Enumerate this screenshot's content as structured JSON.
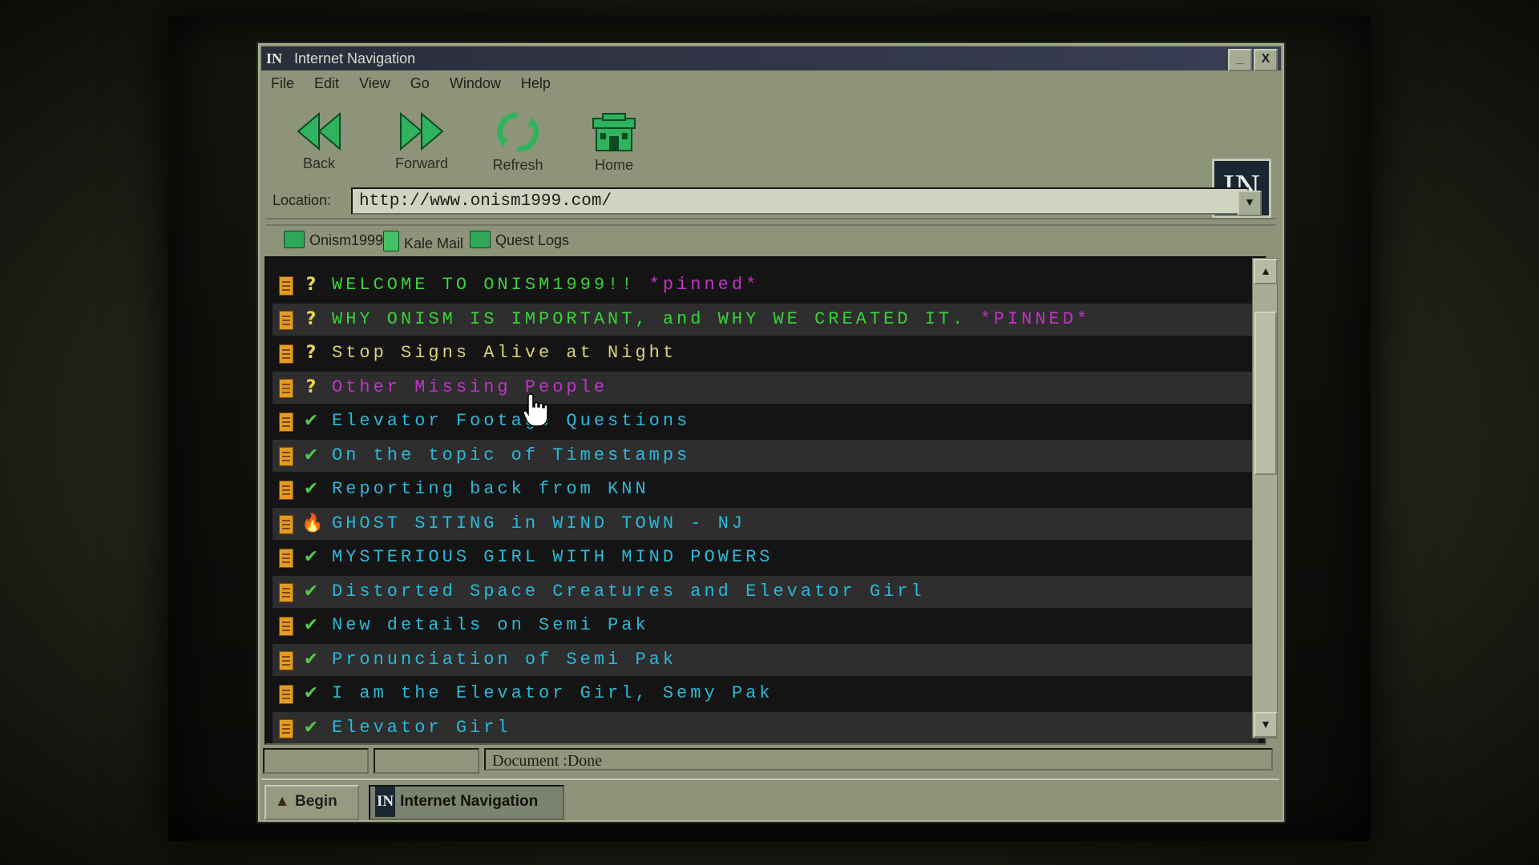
{
  "window": {
    "title": "Internet Navigation",
    "app_icon": "IN",
    "minimize": "_",
    "close": "X"
  },
  "menu": [
    "File",
    "Edit",
    "View",
    "Go",
    "Window",
    "Help"
  ],
  "toolbar": {
    "back": "Back",
    "forward": "Forward",
    "refresh": "Refresh",
    "home": "Home",
    "logo": "IN"
  },
  "location": {
    "label": "Location:",
    "url": "http://www.onism1999.com/"
  },
  "bookmarks": [
    "Onism1999",
    "Kale Mail",
    "Quest Logs"
  ],
  "posts": [
    {
      "status": "?",
      "status_type": "question",
      "title": "WELCOME TO ONISM1999!!",
      "tag": "*pinned*",
      "color": "#39d13a"
    },
    {
      "status": "?",
      "status_type": "question",
      "title": "WHY ONISM IS IMPORTANT, and WHY WE CREATED IT.",
      "tag": "*PINNED*",
      "color": "#39d13a"
    },
    {
      "status": "?",
      "status_type": "question",
      "title": "Stop Signs Alive at Night",
      "tag": "",
      "color": "#d9d476"
    },
    {
      "status": "?",
      "status_type": "question",
      "title": "Other Missing People",
      "tag": "",
      "color": "#c233c9"
    },
    {
      "status": "✔",
      "status_type": "check",
      "title": "Elevator Footage Questions",
      "tag": "",
      "color": "#29b9d8"
    },
    {
      "status": "✔",
      "status_type": "check",
      "title": "On the topic of Timestamps",
      "tag": "",
      "color": "#29b9d8"
    },
    {
      "status": "✔",
      "status_type": "check",
      "title": "Reporting back from KNN",
      "tag": "",
      "color": "#29b9d8"
    },
    {
      "status": "🔥",
      "status_type": "fire",
      "title": "GHOST SITING in WIND TOWN - NJ",
      "tag": "",
      "color": "#29b9d8"
    },
    {
      "status": "✔",
      "status_type": "check",
      "title": "MYSTERIOUS GIRL WITH MIND POWERS",
      "tag": "",
      "color": "#29b9d8"
    },
    {
      "status": "✔",
      "status_type": "check",
      "title": "Distorted Space Creatures and Elevator Girl",
      "tag": "",
      "color": "#29b9d8"
    },
    {
      "status": "✔",
      "status_type": "check",
      "title": "New details on Semi Pak",
      "tag": "",
      "color": "#29b9d8"
    },
    {
      "status": "✔",
      "status_type": "check",
      "title": "Pronunciation of Semi Pak",
      "tag": "",
      "color": "#29b9d8"
    },
    {
      "status": "✔",
      "status_type": "check",
      "title": "I am the Elevator Girl, Semy Pak",
      "tag": "",
      "color": "#29b9d8"
    },
    {
      "status": "✔",
      "status_type": "check",
      "title": "Elevator Girl",
      "tag": "",
      "color": "#29b9d8"
    }
  ],
  "scrollbar": {
    "up": "▲",
    "down": "▼"
  },
  "status": {
    "text": "Document :Done"
  },
  "taskbar": {
    "start_label": "Begin",
    "task_label": "Internet Navigation",
    "task_icon": "IN"
  }
}
